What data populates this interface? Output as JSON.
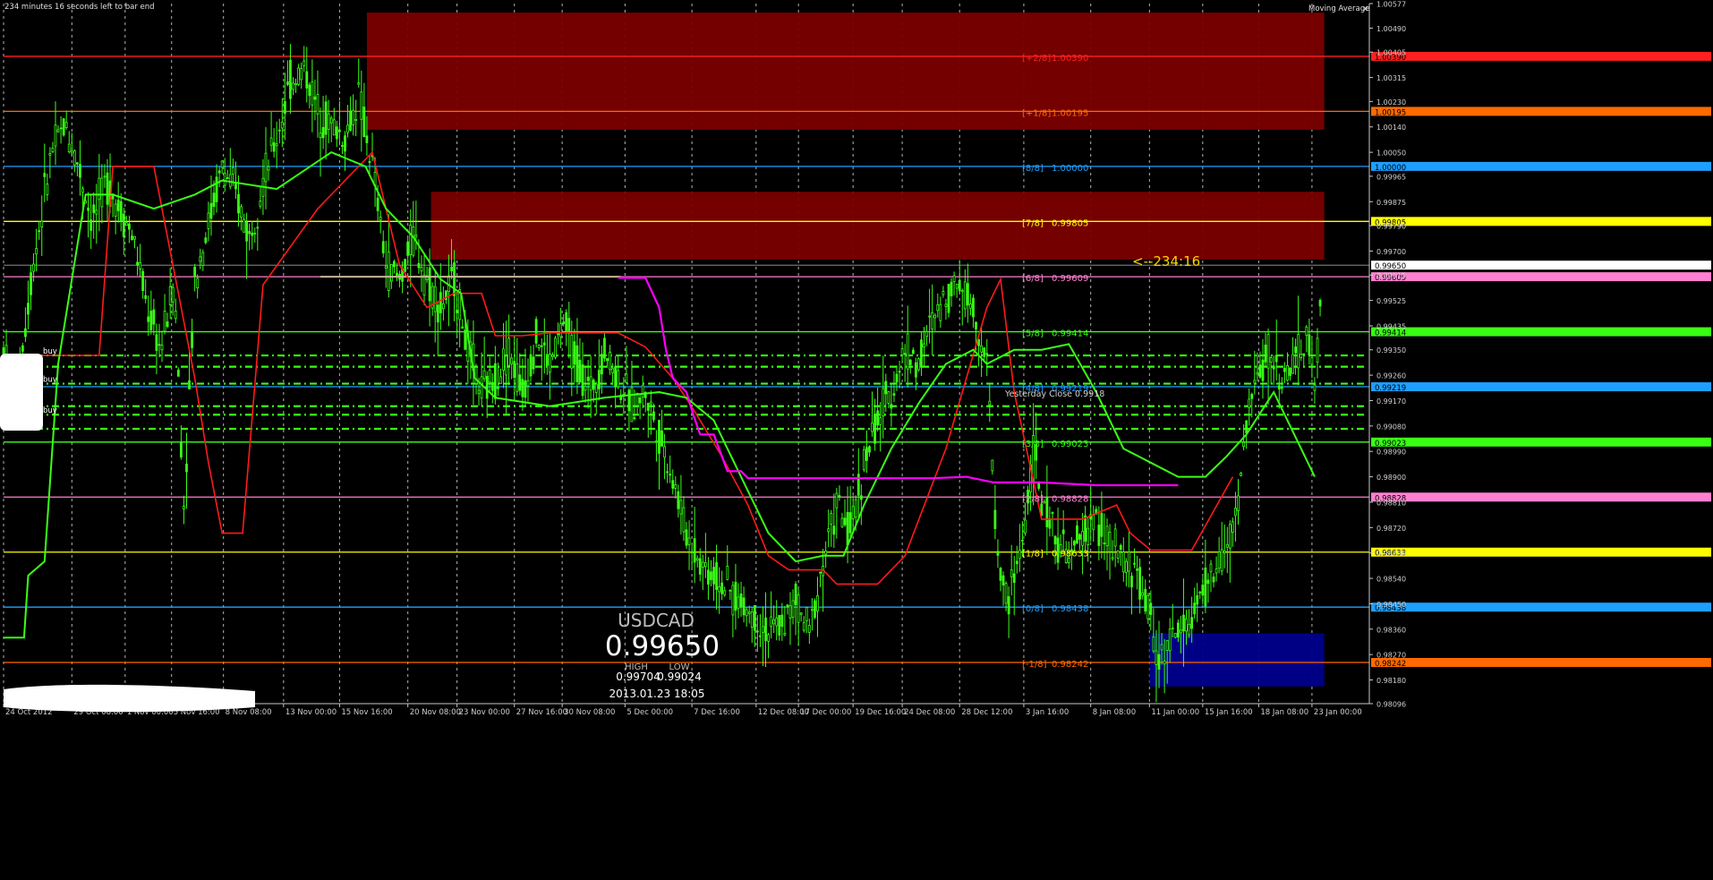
{
  "header": {
    "timer_text": "234 minutes 16 seconds left to bar end",
    "indicator_label": "Moving Average",
    "indicator_close": "✕"
  },
  "colors": {
    "background": "#000000",
    "candles": "#39ff14",
    "grid": "#c8c8c8",
    "zone_red": "#7a0000",
    "zone_blue": "#00008c",
    "ma_red": "#ff1a1a",
    "ma_green": "#39ff14",
    "ma_magenta": "#ff00ff",
    "countdown": "#ffd400"
  },
  "chart_data": {
    "type": "candlestick",
    "symbol": "USDCAD",
    "y_range": [
      0.98096,
      1.00577
    ],
    "x_range_index": [
      0,
      1000
    ],
    "grid": true,
    "price_axis_labels": [
      "1.00577",
      "1.00490",
      "1.00405",
      "1.00315",
      "1.00230",
      "1.00140",
      "1.00050",
      "0.99965",
      "0.99875",
      "0.99790",
      "0.99700",
      "0.99615",
      "0.99525",
      "0.99435",
      "0.99350",
      "0.99260",
      "0.99170",
      "0.99080",
      "0.98990",
      "0.98900",
      "0.98810",
      "0.98720",
      "0.98630",
      "0.98540",
      "0.98450",
      "0.98360",
      "0.98270",
      "0.98180",
      "0.98096"
    ],
    "time_axis_labels": [
      {
        "label": "24 Oct 2012",
        "i": 0
      },
      {
        "label": "29 Oct 08:00",
        "i": 50
      },
      {
        "label": "1 Nov 00:00",
        "i": 89
      },
      {
        "label": "5 Nov 16:00",
        "i": 123
      },
      {
        "label": "8 Nov 08:00",
        "i": 161
      },
      {
        "label": "13 Nov 00:00",
        "i": 205
      },
      {
        "label": "15 Nov 16:00",
        "i": 246
      },
      {
        "label": "20 Nov 08:00",
        "i": 296
      },
      {
        "label": "23 Nov 00:00",
        "i": 332
      },
      {
        "label": "27 Nov 16:00",
        "i": 374
      },
      {
        "label": "30 Nov 08:00",
        "i": 409
      },
      {
        "label": "5 Dec 00:00",
        "i": 455
      },
      {
        "label": "7 Dec 16:00",
        "i": 504
      },
      {
        "label": "12 Dec 08:00",
        "i": 551
      },
      {
        "label": "17 Dec 00:00",
        "i": 582
      },
      {
        "label": "19 Dec 16:00",
        "i": 622
      },
      {
        "label": "24 Dec 08:00",
        "i": 658
      },
      {
        "label": "28 Dec 12:00",
        "i": 700
      },
      {
        "label": "3 Jan 16:00",
        "i": 747
      },
      {
        "label": "8 Jan 08:00",
        "i": 796
      },
      {
        "label": "11 Jan 00:00",
        "i": 839
      },
      {
        "label": "15 Jan 16:00",
        "i": 878
      },
      {
        "label": "18 Jan 08:00",
        "i": 919
      },
      {
        "label": "23 Jan 00:00",
        "i": 958
      }
    ],
    "levels": [
      {
        "tag": "[+2/8]",
        "price": 1.0039,
        "color": "#ff2020",
        "label": "1.00390"
      },
      {
        "tag": "[+1/8]",
        "price": 1.00195,
        "color": "#ff6a00",
        "label": "1.00195"
      },
      {
        "tag": "[8/8]",
        "price": 1.0,
        "color": "#1e9fff",
        "label": "1.00000"
      },
      {
        "tag": "[7/8]",
        "price": 0.99805,
        "color": "#ffff00",
        "label": "0.99805"
      },
      {
        "tag": "[6/8]",
        "price": 0.99609,
        "color": "#ff80d0",
        "label": "0.99609"
      },
      {
        "tag": "[5/8]",
        "price": 0.99414,
        "color": "#39ff14",
        "label": "0.99414"
      },
      {
        "tag": "[4/8]",
        "price": 0.99219,
        "color": "#1e9fff",
        "label": "0.99219"
      },
      {
        "tag": "[3/8]",
        "price": 0.99023,
        "color": "#39ff14",
        "label": "0.99023"
      },
      {
        "tag": "[2/8]",
        "price": 0.98828,
        "color": "#ff80d0",
        "label": "0.98828"
      },
      {
        "tag": "[1/8]",
        "price": 0.98633,
        "color": "#ffff00",
        "label": "0.98633"
      },
      {
        "tag": "[0/8]",
        "price": 0.98438,
        "color": "#1e9fff",
        "label": "0.98438"
      },
      {
        "tag": "[-1/8]",
        "price": 0.98242,
        "color": "#ff6a00",
        "label": "0.98242"
      }
    ],
    "current_price": 0.9965,
    "current_price_label": "0.99650",
    "countdown_label": "<--234:16",
    "yesterday_close_label": "Yesterday Close 0.9918",
    "buy_label": "buy",
    "buy_lines": [
      0.9933,
      0.9929,
      0.9923,
      0.9915,
      0.9912,
      0.9907
    ],
    "zones": [
      {
        "type": "supply",
        "x0": 266,
        "x1": 967,
        "y0": 1.0013,
        "y1": 1.00545
      },
      {
        "type": "supply",
        "x0": 313,
        "x1": 967,
        "y0": 0.9967,
        "y1": 0.9991
      },
      {
        "type": "demand",
        "x0": 839,
        "x1": 967,
        "y0": 0.98157,
        "y1": 0.98345
      }
    ],
    "ma_red": [
      [
        0,
        0.9933
      ],
      [
        70,
        0.9933
      ],
      [
        80,
        1.0
      ],
      [
        110,
        1.0
      ],
      [
        120,
        0.9975
      ],
      [
        130,
        0.995
      ],
      [
        140,
        0.9925
      ],
      [
        150,
        0.9895
      ],
      [
        160,
        0.987
      ],
      [
        175,
        0.987
      ],
      [
        190,
        0.9958
      ],
      [
        230,
        0.9985
      ],
      [
        270,
        1.0005
      ],
      [
        280,
        0.9985
      ],
      [
        290,
        0.9965
      ],
      [
        310,
        0.995
      ],
      [
        330,
        0.9955
      ],
      [
        350,
        0.9955
      ],
      [
        360,
        0.994
      ],
      [
        380,
        0.994
      ],
      [
        400,
        0.9941
      ],
      [
        450,
        0.9941
      ],
      [
        470,
        0.9936
      ],
      [
        490,
        0.9925
      ],
      [
        505,
        0.9914
      ],
      [
        525,
        0.9898
      ],
      [
        545,
        0.988
      ],
      [
        560,
        0.9862
      ],
      [
        575,
        0.9857
      ],
      [
        600,
        0.9857
      ],
      [
        610,
        0.9852
      ],
      [
        640,
        0.9852
      ],
      [
        660,
        0.9862
      ],
      [
        690,
        0.99
      ],
      [
        720,
        0.995
      ],
      [
        730,
        0.996
      ],
      [
        740,
        0.992
      ],
      [
        760,
        0.9875
      ],
      [
        790,
        0.9875
      ],
      [
        815,
        0.988
      ],
      [
        825,
        0.987
      ],
      [
        840,
        0.9864
      ],
      [
        855,
        0.9864
      ],
      [
        870,
        0.9864
      ],
      [
        900,
        0.989
      ]
    ],
    "ma_green": [
      [
        0,
        0.9833
      ],
      [
        15,
        0.9833
      ],
      [
        18,
        0.9855
      ],
      [
        30,
        0.986
      ],
      [
        40,
        0.993
      ],
      [
        60,
        0.999
      ],
      [
        80,
        0.999
      ],
      [
        110,
        0.9985
      ],
      [
        140,
        0.999
      ],
      [
        160,
        0.9995
      ],
      [
        200,
        0.9992
      ],
      [
        240,
        1.0005
      ],
      [
        265,
        1.0
      ],
      [
        280,
        0.9985
      ],
      [
        300,
        0.9975
      ],
      [
        320,
        0.996
      ],
      [
        335,
        0.9955
      ],
      [
        345,
        0.9925
      ],
      [
        360,
        0.9918
      ],
      [
        400,
        0.9915
      ],
      [
        440,
        0.9918
      ],
      [
        480,
        0.992
      ],
      [
        500,
        0.9918
      ],
      [
        520,
        0.991
      ],
      [
        540,
        0.989
      ],
      [
        560,
        0.987
      ],
      [
        580,
        0.986
      ],
      [
        600,
        0.9862
      ],
      [
        615,
        0.9862
      ],
      [
        630,
        0.988
      ],
      [
        650,
        0.99
      ],
      [
        670,
        0.9916
      ],
      [
        690,
        0.993
      ],
      [
        710,
        0.9935
      ],
      [
        720,
        0.993
      ],
      [
        740,
        0.9935
      ],
      [
        760,
        0.9935
      ],
      [
        780,
        0.9937
      ],
      [
        800,
        0.992
      ],
      [
        820,
        0.99
      ],
      [
        840,
        0.9895
      ],
      [
        860,
        0.989
      ],
      [
        880,
        0.989
      ],
      [
        895,
        0.9897
      ],
      [
        910,
        0.9905
      ],
      [
        930,
        0.992
      ],
      [
        960,
        0.989
      ]
    ],
    "ma_magenta": [
      [
        450,
        0.99605
      ],
      [
        470,
        0.99605
      ],
      [
        480,
        0.995
      ],
      [
        485,
        0.9935
      ],
      [
        490,
        0.9925
      ],
      [
        500,
        0.992
      ],
      [
        505,
        0.9912
      ],
      [
        510,
        0.9905
      ],
      [
        520,
        0.9905
      ],
      [
        530,
        0.9892
      ],
      [
        540,
        0.9892
      ],
      [
        545,
        0.98895
      ],
      [
        680,
        0.98895
      ],
      [
        705,
        0.989
      ],
      [
        725,
        0.9888
      ],
      [
        760,
        0.9888
      ],
      [
        800,
        0.9887
      ],
      [
        860,
        0.9887
      ]
    ],
    "ma_tan": [
      [
        232,
        0.99609
      ],
      [
        300,
        0.99609
      ],
      [
        420,
        0.99609
      ],
      [
        452,
        0.99609
      ]
    ],
    "candles_sketch_note_ignore": "",
    "symbol_label": "USDCAD",
    "bid_label": "0.99650",
    "high_label": "HIGH",
    "low_label": "LOW",
    "high_value": "0.99704",
    "low_value": "0.99024",
    "datetime_label": "2013.01.23 18:05"
  }
}
